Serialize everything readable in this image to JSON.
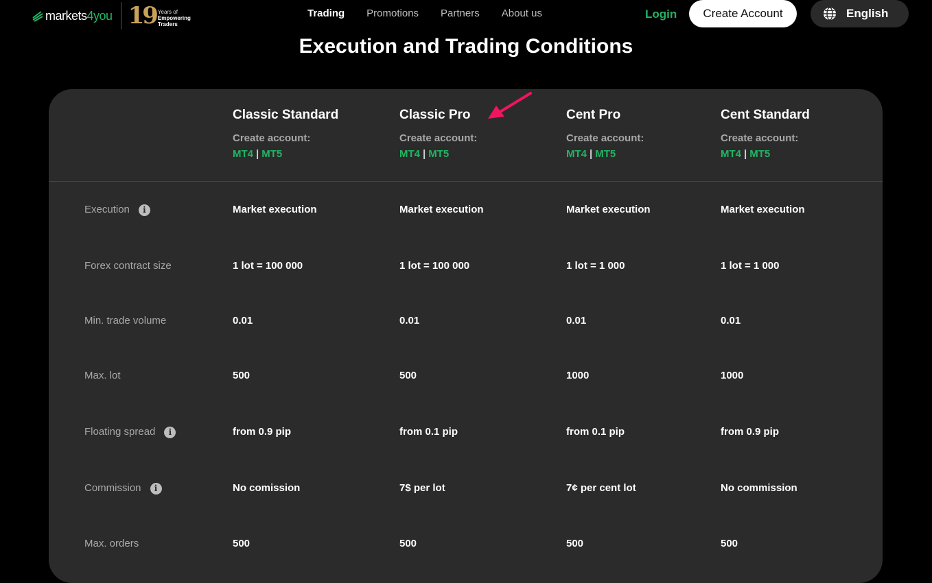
{
  "header": {
    "brand_prefix": "markets",
    "brand_suffix": "4you",
    "badge_number": "19",
    "badge_line1": "Years of",
    "badge_line2": "Empowering",
    "badge_line3": "Traders",
    "nav": [
      {
        "label": "Trading",
        "active": true
      },
      {
        "label": "Promotions",
        "active": false
      },
      {
        "label": "Partners",
        "active": false
      },
      {
        "label": "About us",
        "active": false
      }
    ],
    "login_label": "Login",
    "create_account_label": "Create Account",
    "language_label": "English"
  },
  "section": {
    "title": "Execution and Trading Conditions"
  },
  "table": {
    "create_label": "Create account:",
    "platforms": [
      "MT4",
      "MT5"
    ],
    "columns": [
      "Classic Standard",
      "Classic Pro",
      "Cent Pro",
      "Cent Standard"
    ],
    "rows": [
      {
        "label": "Execution",
        "info": true,
        "values": [
          "Market execution",
          "Market execution",
          "Market execution",
          "Market execution"
        ]
      },
      {
        "label": "Forex contract size",
        "info": false,
        "values": [
          "1 lot = 100 000",
          "1 lot = 100 000",
          "1 lot = 1 000",
          "1 lot = 1 000"
        ]
      },
      {
        "label": "Min. trade volume",
        "info": false,
        "values": [
          "0.01",
          "0.01",
          "0.01",
          "0.01"
        ]
      },
      {
        "label": "Max. lot",
        "info": false,
        "values": [
          "500",
          "500",
          "1000",
          "1000"
        ]
      },
      {
        "label": "Floating spread",
        "info": true,
        "values": [
          "from 0.9 pip",
          "from 0.1 pip",
          "from 0.1 pip",
          "from 0.9 pip"
        ]
      },
      {
        "label": "Commission",
        "info": true,
        "values": [
          "No comission",
          "7$ per lot",
          "7¢ per cent lot",
          "No commission"
        ]
      },
      {
        "label": "Max. orders",
        "info": false,
        "values": [
          "500",
          "500",
          "500",
          "500"
        ]
      }
    ]
  },
  "colors": {
    "accent_green": "#22b463",
    "card_bg": "#2b2b2b",
    "annotation_arrow": "#f0155f"
  }
}
